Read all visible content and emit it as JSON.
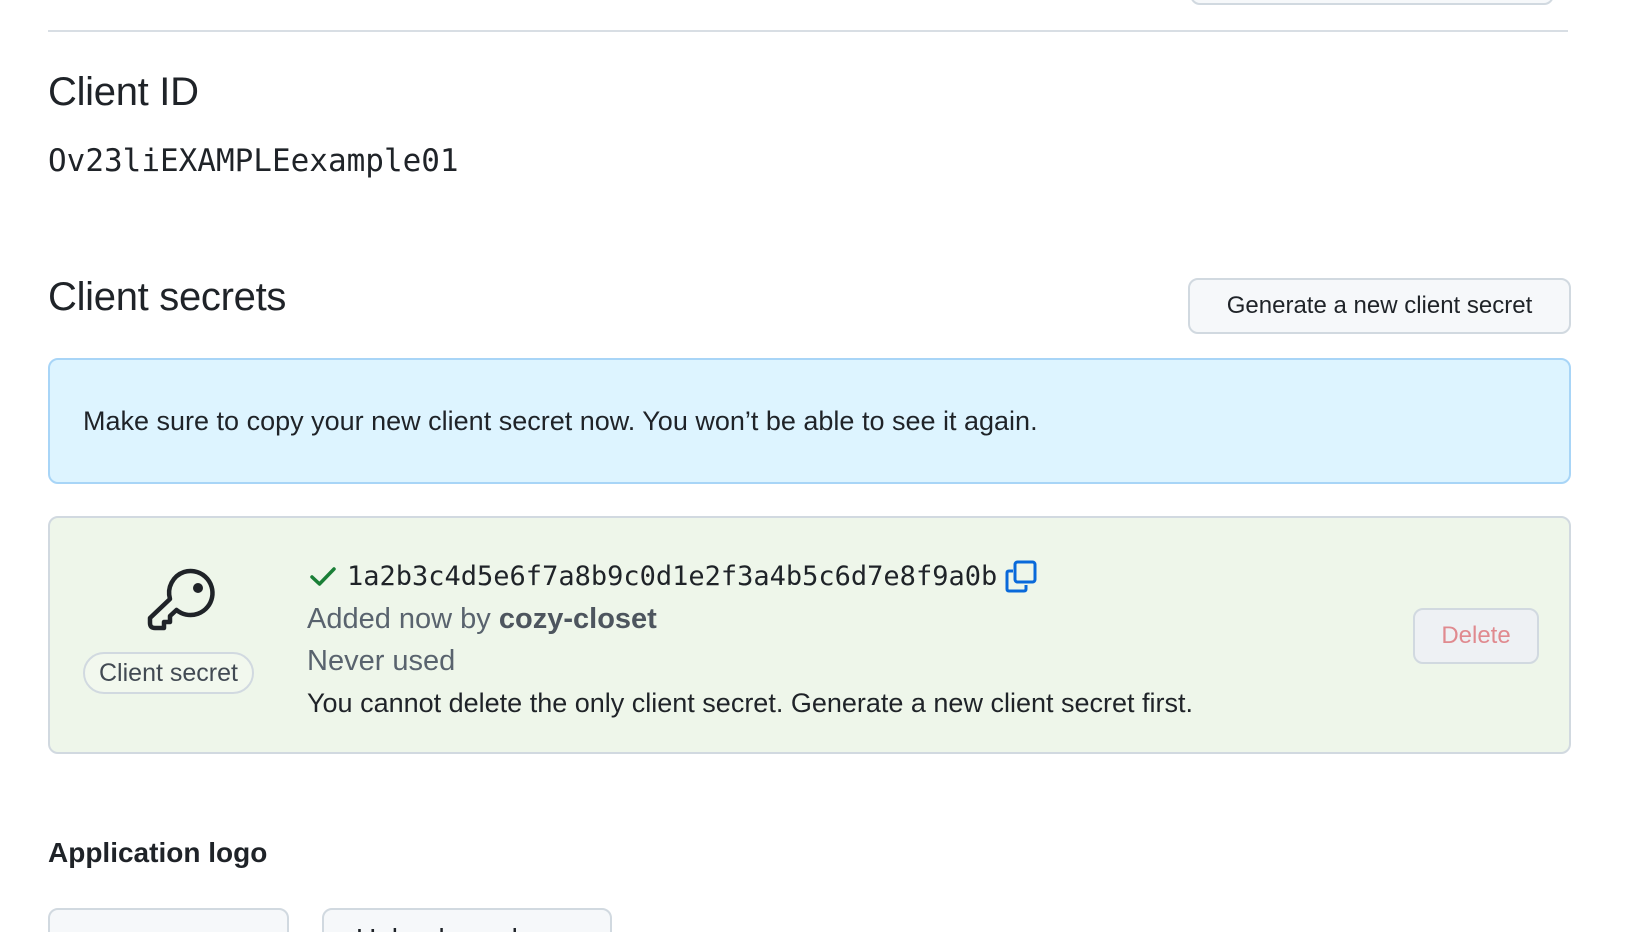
{
  "client_id": {
    "heading": "Client ID",
    "value": "Ov23liEXAMPLEexample01"
  },
  "client_secrets": {
    "heading": "Client secrets",
    "generate_button": "Generate a new client secret",
    "flash_message": "Make sure to copy your new client secret now. You won’t be able to see it again.",
    "secret": {
      "badge_label": "Client secret",
      "value": "1a2b3c4d5e6f7a8b9c0d1e2f3a4b5c6d7e8f9a0b",
      "added_prefix": "Added now by",
      "added_by": "cozy-closet",
      "usage": "Never used",
      "delete_note": "You cannot delete the only client secret. Generate a new client secret first.",
      "delete_button": "Delete",
      "delete_disabled": true
    }
  },
  "application_logo": {
    "heading": "Application logo",
    "upload_button": "Upload new logo"
  },
  "colors": {
    "flash_bg": "#ddf4ff",
    "secret_bg": "#eef6ea",
    "success": "#1a7f37",
    "link": "#0969da",
    "danger_disabled": "#e08a8f"
  },
  "icons": {
    "key": "key-icon",
    "check": "check-icon",
    "copy": "copy-icon"
  }
}
